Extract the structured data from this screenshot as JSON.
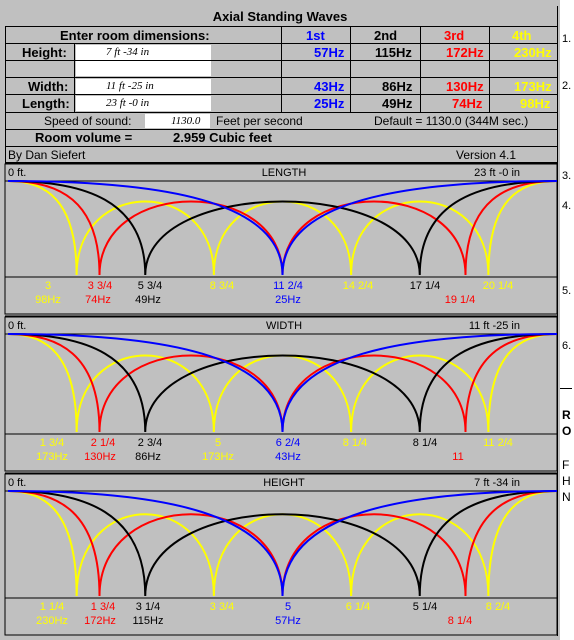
{
  "title": "Axial Standing Waves",
  "room": {
    "header": "Enter room dimensions:",
    "height_label": "Height:",
    "height_value": "7 ft  -34 in",
    "width_label": "Width:",
    "width_value": "11 ft  -25 in",
    "length_label": "Length:",
    "length_value": "23 ft  -0 in"
  },
  "harmonics": {
    "headers": [
      "1st",
      "2nd",
      "3rd",
      "4th"
    ],
    "height": [
      "57Hz",
      "115Hz",
      "172Hz",
      "230Hz"
    ],
    "width": [
      "43Hz",
      "86Hz",
      "130Hz",
      "173Hz"
    ],
    "length": [
      "25Hz",
      "49Hz",
      "74Hz",
      "98Hz"
    ]
  },
  "speed": {
    "label": "Speed of sound:",
    "value": "1130.0",
    "units": "Feet per second",
    "default": "Default = 1130.0 (344M sec.)"
  },
  "volume": {
    "label": "Room volume =",
    "value": "2.959 Cubic feet"
  },
  "author": "By Dan Siefert",
  "version": "Version 4.1",
  "panels": [
    {
      "title": "LENGTH",
      "left_label": "0 ft.",
      "right_label": "23 ft -0 in",
      "positions": [
        "3",
        "3 3/4",
        "5 3/4",
        "8 3/4",
        "11 2/4",
        "14 2/4",
        "17 1/4",
        "20 1/4"
      ],
      "freqs_row": [
        "98Hz",
        "74Hz",
        "49Hz",
        "25Hz"
      ],
      "extra": "19 1/4"
    },
    {
      "title": "WIDTH",
      "left_label": "0 ft.",
      "right_label": "11 ft -25 in",
      "positions": [
        "1 3/4",
        "2 1/4",
        "2 3/4",
        "5",
        "6 2/4",
        "8 1/4",
        "8 1/4",
        "11 2/4"
      ],
      "freqs_row": [
        "173Hz",
        "130Hz",
        "86Hz",
        "173Hz",
        "43Hz"
      ],
      "extra": "11"
    },
    {
      "title": "HEIGHT",
      "left_label": "0 ft.",
      "right_label": "7 ft -34 in",
      "positions": [
        "1 1/4",
        "1 3/4",
        "3 1/4",
        "3 3/4",
        "5",
        "6 1/4",
        "5 1/4",
        "8 2/4"
      ],
      "freqs_row": [
        "230Hz",
        "172Hz",
        "115Hz",
        "57Hz"
      ],
      "extra": "8 1/4"
    }
  ],
  "right_strip": {
    "numbers": [
      "1.",
      "2.",
      "3.",
      "4.",
      "5.",
      "6."
    ],
    "letters": [
      "R",
      "O",
      "F",
      "H",
      "N"
    ]
  },
  "colors": {
    "first": "#0000ff",
    "second": "#000000",
    "third": "#ff0000",
    "fourth": "#ffff00",
    "background": "#c0c0c0"
  }
}
